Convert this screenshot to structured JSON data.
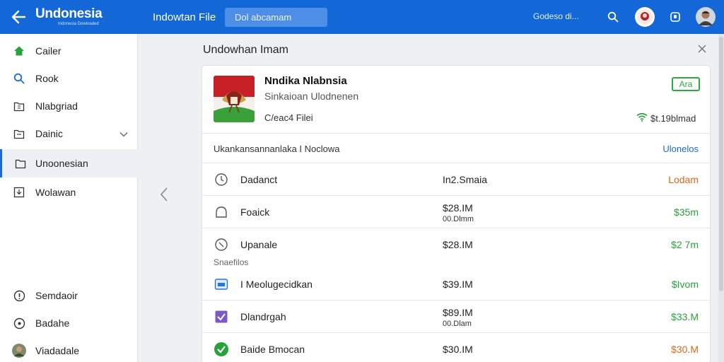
{
  "header": {
    "brand": "Undonesia",
    "brand_tagline": "Indonesia Dowloaded",
    "crumb": "Indowtan File",
    "search_value": "Dol abcamam",
    "status": "Godeso di..."
  },
  "sidebar": {
    "items": [
      {
        "label": "Cailer",
        "icon": "home-icon"
      },
      {
        "label": "Rook",
        "icon": "search-icon"
      },
      {
        "label": "Nlabgriad",
        "icon": "folder-icon"
      },
      {
        "label": "Dainic",
        "icon": "folder-icon"
      },
      {
        "label": "Unoonesian",
        "icon": "folder-icon"
      },
      {
        "label": "Wolawan",
        "icon": "download-icon"
      }
    ],
    "bottom": [
      {
        "label": "Semdaoir",
        "icon": "info-icon"
      },
      {
        "label": "Badahe",
        "icon": "location-icon"
      },
      {
        "label": "Viadadale",
        "icon": "avatar"
      }
    ]
  },
  "panel": {
    "title": "Undowhan Imam",
    "app": {
      "name": "Nndika Nlabnsia",
      "desc": "Sinkaioan Ulodnenen",
      "files": "C/eac4 Filei",
      "badge": "Ara",
      "speed": "$t.19blmad"
    },
    "section_label": "Ukankansannanlaka I Noclowa",
    "section_link": "Ulonelos",
    "subhead": "Snaefilos",
    "rows": [
      {
        "name": "Dadanct",
        "size": "In2.Smaia",
        "size_sub": "",
        "price": "Lodam",
        "price_color": "#d9681b",
        "icon": "timer-icon"
      },
      {
        "name": "Foaick",
        "size": "$28.IM",
        "size_sub": "00.Dlmm",
        "price": "$35m",
        "price_color": "#27a339",
        "icon": "cloud-icon"
      },
      {
        "name": "Upanale",
        "size": "$28.IM",
        "size_sub": "",
        "price": "$2 7m",
        "price_color": "#27a339",
        "icon": "gauge-icon"
      },
      {
        "name": "I Meolugecidkan",
        "size": "$39.IM",
        "size_sub": "",
        "price": "$Ivom",
        "price_color": "#27a339",
        "icon": "window-icon"
      },
      {
        "name": "Dlandrgah",
        "size": "$89.IM",
        "size_sub": "00.Dlam",
        "price": "$33.M",
        "price_color": "#27a339",
        "icon": "check-box-icon"
      },
      {
        "name": "Baide Bmocan",
        "size": "$30.IM",
        "size_sub": "",
        "price": "$30.M",
        "price_color": "#d9681b",
        "icon": "check-circle-icon"
      }
    ]
  },
  "colors": {
    "accent": "#1467d6",
    "green": "#27a339",
    "orange": "#d9681b"
  }
}
